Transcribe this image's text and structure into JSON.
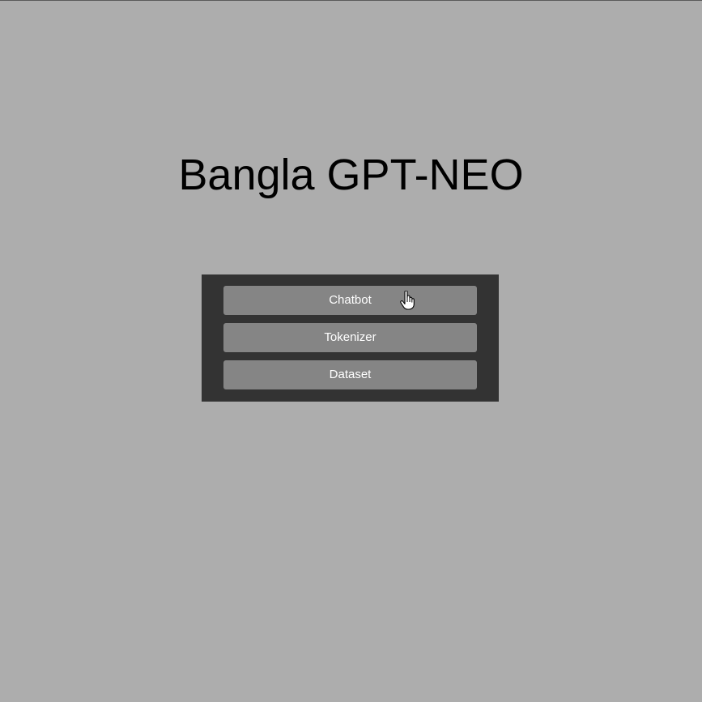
{
  "page": {
    "title": "Bangla GPT-NEO"
  },
  "nav": {
    "items": [
      {
        "label": "Chatbot"
      },
      {
        "label": "Tokenizer"
      },
      {
        "label": "Dataset"
      }
    ]
  },
  "cursor": {
    "icon": "hand-pointer-icon"
  },
  "colors": {
    "background": "#adadad",
    "panel": "#333333",
    "button": "#858585",
    "button_text": "#ffffff",
    "title_text": "#000000"
  }
}
